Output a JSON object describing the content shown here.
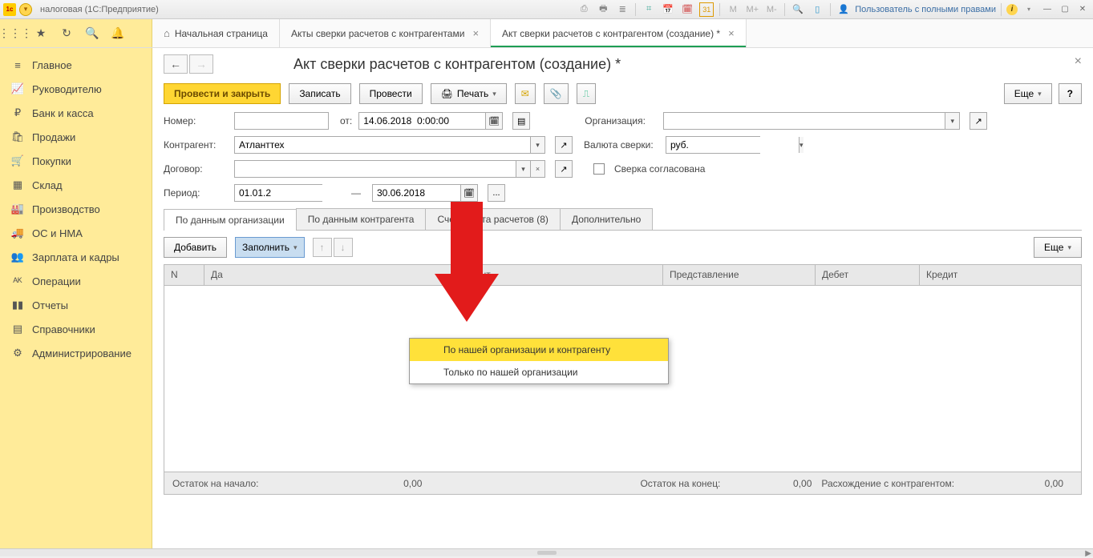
{
  "titlebar": {
    "logo_text": "1c",
    "title": "налоговая  (1С:Предприятие)",
    "user_label": "Пользователь с полными правами",
    "m_labels": [
      "M",
      "M+",
      "M-"
    ],
    "cal_text": "31"
  },
  "tabs": {
    "home": "Начальная страница",
    "t1": "Акты сверки расчетов с контрагентами",
    "t2": "Акт сверки расчетов с контрагентом (создание) *"
  },
  "sidebar": {
    "items": [
      {
        "label": "Главное"
      },
      {
        "label": "Руководителю"
      },
      {
        "label": "Банк и касса"
      },
      {
        "label": "Продажи"
      },
      {
        "label": "Покупки"
      },
      {
        "label": "Склад"
      },
      {
        "label": "Производство"
      },
      {
        "label": "ОС и НМА"
      },
      {
        "label": "Зарплата и кадры"
      },
      {
        "label": "Операции"
      },
      {
        "label": "Отчеты"
      },
      {
        "label": "Справочники"
      },
      {
        "label": "Администрирование"
      }
    ]
  },
  "page": {
    "title": "Акт сверки расчетов с контрагентом (создание) *"
  },
  "toolbar": {
    "submit_close": "Провести и закрыть",
    "save": "Записать",
    "post": "Провести",
    "print": "Печать",
    "more": "Еще",
    "help": "?"
  },
  "form": {
    "number_lbl": "Номер:",
    "number_val": "",
    "from_lbl": "от:",
    "date_val": "14.06.2018  0:00:00",
    "org_lbl": "Организация:",
    "org_val": "",
    "contr_lbl": "Контрагент:",
    "contr_val": "Атланттех",
    "currency_lbl": "Валюта сверки:",
    "currency_val": "руб.",
    "contract_lbl": "Договор:",
    "contract_val": "",
    "agreed_lbl": "Сверка согласована",
    "period_lbl": "Период:",
    "period_from": "01.01.2",
    "period_to": "30.06.2018",
    "ellipsis": "..."
  },
  "tabstrip": {
    "t1": "По данным организации",
    "t2": "По данным контрагента",
    "t3": "Счета учета расчетов (8)",
    "t4": "Дополнительно"
  },
  "inner": {
    "add": "Добавить",
    "fill": "Заполнить",
    "more": "Еще"
  },
  "dropdown": {
    "i1": "По нашей организации и контрагенту",
    "i2": "Только по нашей организации"
  },
  "columns": {
    "c1": "N",
    "c2": "Да",
    "c3": "ент",
    "c4": "Представление",
    "c5": "Дебет",
    "c6": "Кредит"
  },
  "footer": {
    "l1": "Остаток на начало:",
    "v1": "0,00",
    "l2": "Остаток на конец:",
    "v2": "0,00",
    "l3": "Расхождение с контрагентом:",
    "v3": "0,00"
  }
}
